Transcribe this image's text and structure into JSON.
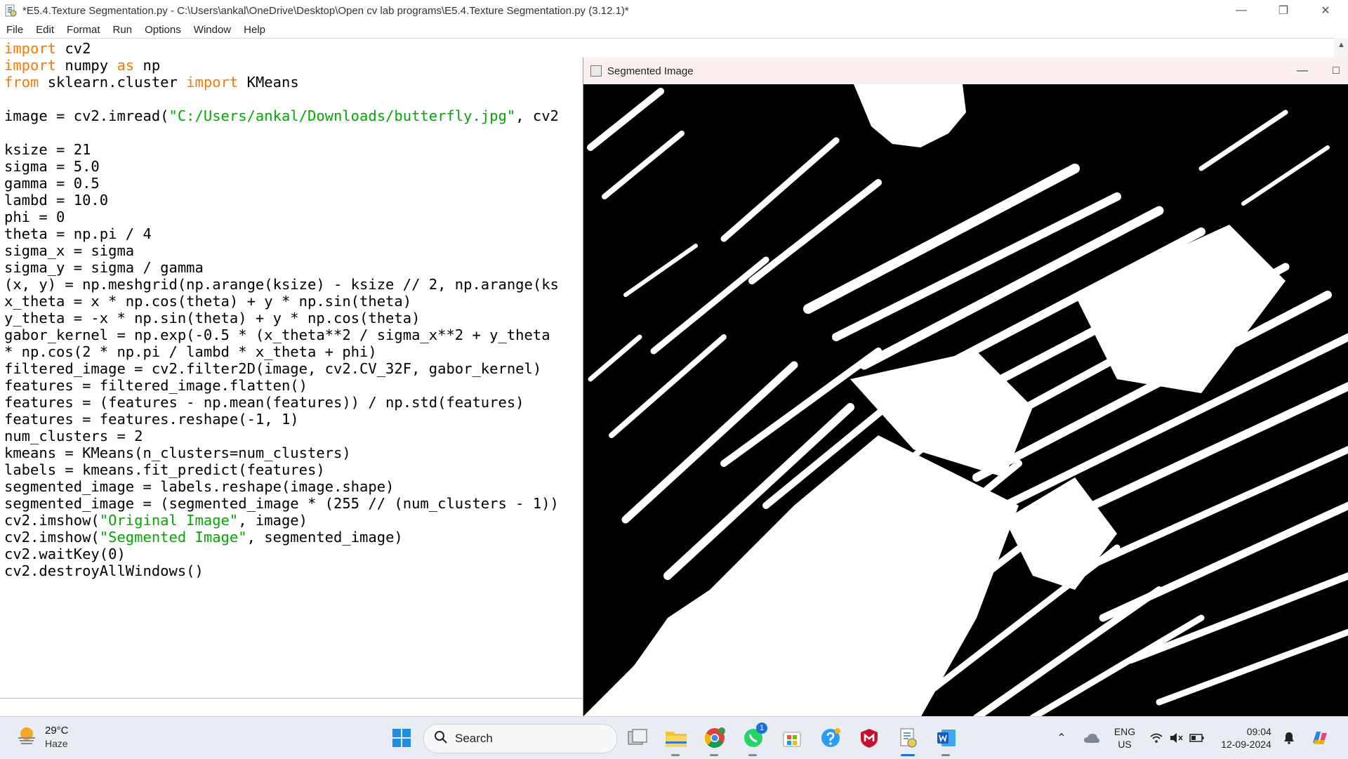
{
  "window": {
    "title": "*E5.4.Texture Segmentation.py - C:\\Users\\ankal\\OneDrive\\Desktop\\Open cv lab programs\\E5.4.Texture Segmentation.py (3.12.1)*"
  },
  "menu": [
    "File",
    "Edit",
    "Format",
    "Run",
    "Options",
    "Window",
    "Help"
  ],
  "code_lines": [
    [
      {
        "t": "import",
        "c": "kw"
      },
      {
        "t": " cv2"
      }
    ],
    [
      {
        "t": "import",
        "c": "kw"
      },
      {
        "t": " numpy "
      },
      {
        "t": "as",
        "c": "kw"
      },
      {
        "t": " np"
      }
    ],
    [
      {
        "t": "from",
        "c": "kw"
      },
      {
        "t": " sklearn.cluster "
      },
      {
        "t": "import",
        "c": "kw"
      },
      {
        "t": " KMeans"
      }
    ],
    [
      {
        "t": ""
      }
    ],
    [
      {
        "t": "image = cv2.imread("
      },
      {
        "t": "\"C:/Users/ankal/Downloads/butterfly.jpg\"",
        "c": "str"
      },
      {
        "t": ", cv2"
      }
    ],
    [
      {
        "t": ""
      }
    ],
    [
      {
        "t": "ksize = 21"
      }
    ],
    [
      {
        "t": "sigma = 5.0"
      }
    ],
    [
      {
        "t": "gamma = 0.5"
      }
    ],
    [
      {
        "t": "lambd = 10.0"
      }
    ],
    [
      {
        "t": "phi = 0"
      }
    ],
    [
      {
        "t": "theta = np.pi / 4"
      }
    ],
    [
      {
        "t": "sigma_x = sigma"
      }
    ],
    [
      {
        "t": "sigma_y = sigma / gamma"
      }
    ],
    [
      {
        "t": "(x, y) = np.meshgrid(np.arange(ksize) - ksize // 2, np.arange(ks"
      }
    ],
    [
      {
        "t": "x_theta = x * np.cos(theta) + y * np.sin(theta)"
      }
    ],
    [
      {
        "t": "y_theta = -x * np.sin(theta) + y * np.cos(theta)"
      }
    ],
    [
      {
        "t": "gabor_kernel = np.exp(-0.5 * (x_theta**2 / sigma_x**2 + y_theta"
      }
    ],
    [
      {
        "t": "* np.cos(2 * np.pi / lambd * x_theta + phi)"
      }
    ],
    [
      {
        "t": "filtered_image = cv2.filter2D(image, cv2.CV_32F, gabor_kernel)"
      }
    ],
    [
      {
        "t": "features = filtered_image.flatten()"
      }
    ],
    [
      {
        "t": "features = (features - np.mean(features)) / np.std(features)"
      }
    ],
    [
      {
        "t": "features = features.reshape(-1, 1)"
      }
    ],
    [
      {
        "t": "num_clusters = 2"
      }
    ],
    [
      {
        "t": "kmeans = KMeans(n_clusters=num_clusters)"
      }
    ],
    [
      {
        "t": "labels = kmeans.fit_predict(features)"
      }
    ],
    [
      {
        "t": "segmented_image = labels.reshape(image.shape)"
      }
    ],
    [
      {
        "t": "segmented_image = (segmented_image * (255 // (num_clusters - 1))"
      }
    ],
    [
      {
        "t": "cv2.imshow("
      },
      {
        "t": "\"Original Image\"",
        "c": "str"
      },
      {
        "t": ", image)"
      }
    ],
    [
      {
        "t": "cv2.imshow("
      },
      {
        "t": "\"Segmented Image\"",
        "c": "str"
      },
      {
        "t": ", segmented_image)"
      }
    ],
    [
      {
        "t": "cv2.waitKey(0)"
      }
    ],
    [
      {
        "t": "cv2.destroyAllWindows()"
      }
    ]
  ],
  "cv_window": {
    "title": "Segmented Image"
  },
  "taskbar": {
    "weather_temp": "29°C",
    "weather_cond": "Haze",
    "search_label": "Search",
    "whatsapp_badge": "1",
    "lang_top": "ENG",
    "lang_bottom": "US",
    "time": "09:04",
    "date": "12-09-2024"
  },
  "colors": {
    "keyword": "#ff7700",
    "string": "#00aa00",
    "taskbar_bg": "#e9edf3"
  }
}
